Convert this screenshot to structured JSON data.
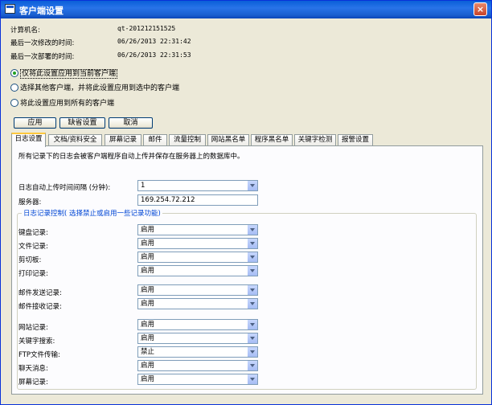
{
  "window": {
    "title": "客户端设置",
    "close_glyph": "×"
  },
  "info": [
    {
      "label": "计算机名:",
      "value": "qt-201212151525"
    },
    {
      "label": "最后一次修改的时间:",
      "value": "06/26/2013 22:31:42"
    },
    {
      "label": "最后一次部署的时间:",
      "value": "06/26/2013 22:31:53"
    }
  ],
  "radios": [
    {
      "label": "仅将此设置应用到当前客户端",
      "checked": true
    },
    {
      "label": "选择其他客户端，并将此设置应用到选中的客户端",
      "checked": false
    },
    {
      "label": "将此设置应用到所有的客户端",
      "checked": false
    }
  ],
  "buttons": {
    "apply": "应用",
    "default": "缺省设置",
    "cancel": "取消"
  },
  "tabs": [
    "日志设置",
    "文档/资料安全",
    "屏幕记录",
    "邮件",
    "流量控制",
    "网站黑名单",
    "程序黑名单",
    "关键字检测",
    "报警设置"
  ],
  "log": {
    "description": "所有记录下的日志会被客户端程序自动上传并保存在服务器上的数据库中。",
    "interval_label": "日志自动上传时间间隔 (分钟):",
    "interval_value": "1",
    "server_label": "服务器:",
    "server_value": "169.254.72.212",
    "group_title": "日志记录控制( 选择禁止或启用一些记录功能)",
    "controls": [
      {
        "label": "键盘记录:",
        "value": "启用"
      },
      {
        "label": "文件记录:",
        "value": "启用"
      },
      {
        "label": "剪切板:",
        "value": "启用"
      },
      {
        "label": "打印记录:",
        "value": "启用"
      },
      {
        "label": "邮件发送记录:",
        "value": "启用"
      },
      {
        "label": "邮件接收记录:",
        "value": "启用"
      },
      {
        "label": "网站记录:",
        "value": "启用"
      },
      {
        "label": "关键字搜索:",
        "value": "启用"
      },
      {
        "label": "FTP文件传输:",
        "value": "禁止"
      },
      {
        "label": "聊天消息:",
        "value": "启用"
      },
      {
        "label": "屏幕记录:",
        "value": "启用"
      }
    ]
  },
  "colors": {
    "titlebar": "#0a5fd8",
    "window_bg": "#ece9d8",
    "group_title": "#0046d5",
    "active_tab_accent": "#ffc83c"
  }
}
